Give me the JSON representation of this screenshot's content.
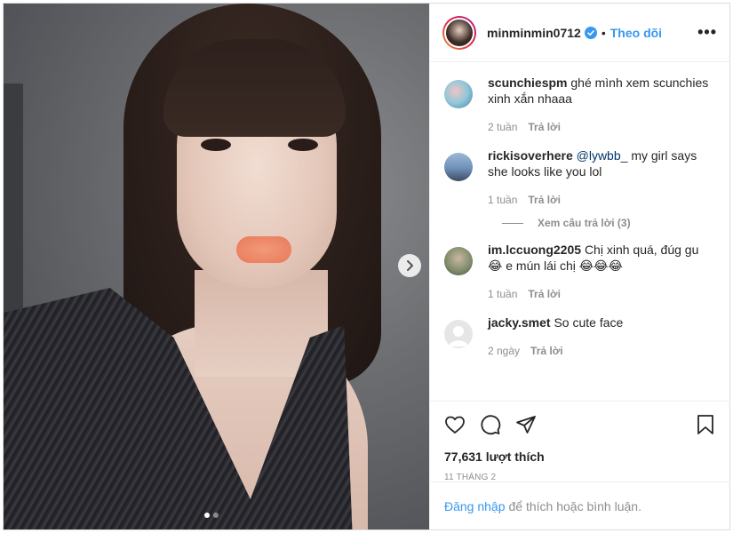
{
  "post": {
    "author": {
      "username": "minminmin0712",
      "verified": true,
      "follow_label": "Theo dõi",
      "separator": "•",
      "more_icon": "more-icon"
    },
    "carousel": {
      "slide_count": 2,
      "active_slide": 1
    },
    "comments": [
      {
        "username": "scunchiespm",
        "mention": "",
        "text": "ghé mình xem scunchies xinh xắn nhaaa",
        "time": "2 tuần",
        "reply_label": "Trả lời",
        "avatar_color": "#8fc7d8"
      },
      {
        "username": "rickisoverhere",
        "mention": "@lywbb_",
        "text": "my girl says she looks like you lol",
        "time": "1 tuần",
        "reply_label": "Trả lời",
        "avatar_color": "#6f8fb8",
        "view_replies": "Xem câu trả lời (3)"
      },
      {
        "username": "im.lccuong2205",
        "mention": "",
        "text": "Chị xinh quá, đúg gu 😂 e mún lái chị 😂😂😂",
        "time": "1 tuần",
        "reply_label": "Trả lời",
        "avatar_color": "#7d8a6a"
      },
      {
        "username": "jacky.smet",
        "mention": "",
        "text": "So cute face",
        "time": "2 ngày",
        "reply_label": "Trả lời",
        "avatar_color": "#d9d9d9"
      }
    ],
    "likes": "77,631 lượt thích",
    "date": "11 THÁNG 2",
    "login": {
      "link": "Đăng nhập",
      "text": "để thích hoặc bình luận."
    }
  },
  "colors": {
    "accent": "#3897f0",
    "text": "#262626",
    "muted": "#8e8e8e",
    "border": "#efefef"
  }
}
